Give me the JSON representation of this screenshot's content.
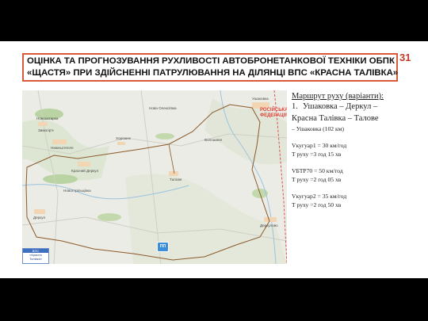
{
  "slide": {
    "number": "31",
    "title_line1": "ОЦІНКА ТА ПРОГНОЗУВАННЯ РУХЛИВОСТІ АВТОБРОНЕТАНКОВОЇ ТЕХНІКИ ОБПК",
    "title_line2": "«ЩАСТЯ» ПРИ ЗДІЙСНЕННІ ПАТРУЛЮВАННЯ НА ДІЛЯНЦІ ВПС «КРАСНА ТАЛІВКА»"
  },
  "map": {
    "country_label": "РОСІЙСЬКА ФЕДЕРАЦІЯ",
    "checkpoint_title": "ВПС",
    "checkpoint_name": "«Красна Талівка»",
    "pp_marker": "ПП",
    "places": [
      "Новоохтирка",
      "Зимогір'я",
      "Нижньотепле",
      "Красний Деркул",
      "Деркул",
      "Талове",
      "Ушаковка",
      "Деркулово",
      "Хорошеє",
      "Волошине",
      "Новострільцівка",
      "Нова Олексіївка"
    ]
  },
  "info": {
    "heading": "Маршрут руху (варіанти):",
    "route_number": "1.",
    "route_line1": "Ушаковка – Деркул –",
    "route_line2": "Красна Талівка – Талове",
    "route_line3": "– Ушаковка (102 км)",
    "v1": "Vкугуар1 = 30 км/год",
    "t1": "Т руху =3 год 15 хв",
    "v2": "VБТР70 = 50 км/год",
    "t2": "Т руху =2 год 05 хв",
    "v3": "Vкугуар2 = 35 км/год",
    "t3": "Т руху =2 год 50 хв"
  },
  "colors": {
    "title_border": "#d85a3a",
    "slide_number": "#c0392b",
    "route_line": "#8a5a2b",
    "country": "#e0443a"
  }
}
